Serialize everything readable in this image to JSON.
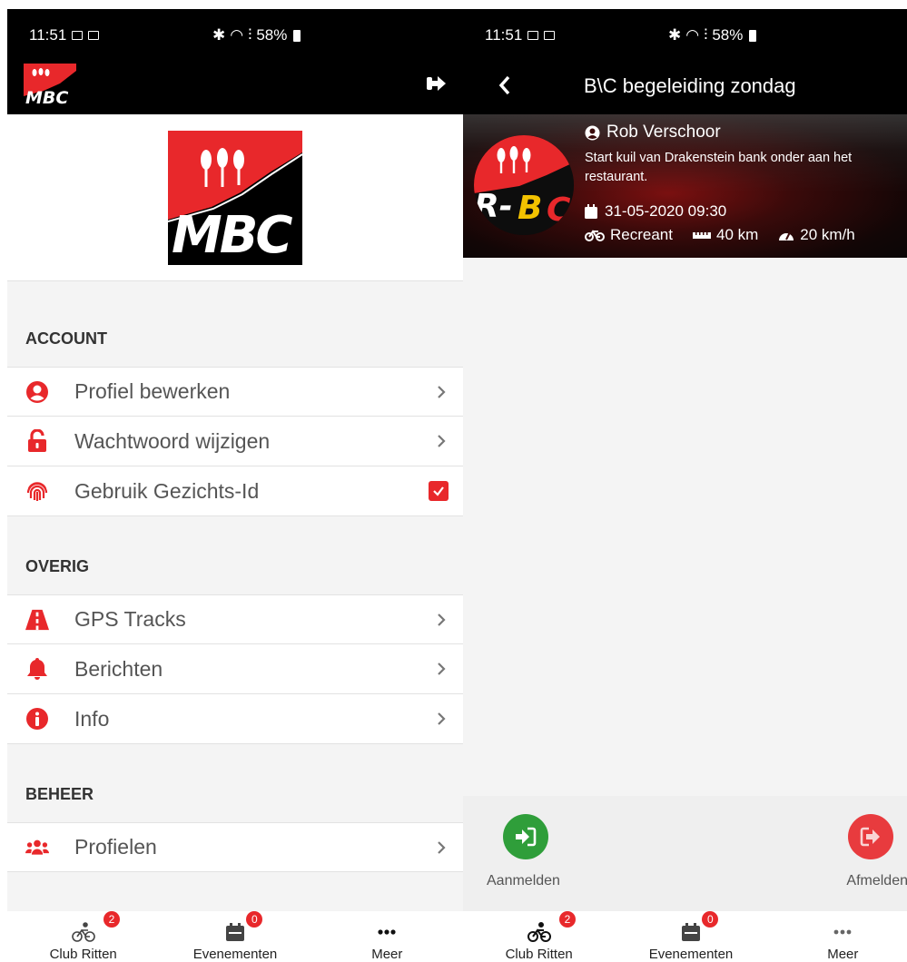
{
  "status_bar": {
    "time": "11:51",
    "battery": "58%"
  },
  "left": {
    "sections": [
      {
        "title": "ACCOUNT",
        "items": [
          {
            "label": "Profiel bewerken",
            "icon": "user-circle-icon",
            "type": "chevron"
          },
          {
            "label": "Wachtwoord wijzigen",
            "icon": "lock-open-icon",
            "type": "chevron"
          },
          {
            "label": "Gebruik Gezichts-Id",
            "icon": "fingerprint-icon",
            "type": "checkbox",
            "checked": true
          }
        ]
      },
      {
        "title": "OVERIG",
        "items": [
          {
            "label": "GPS Tracks",
            "icon": "road-icon",
            "type": "chevron"
          },
          {
            "label": "Berichten",
            "icon": "bell-icon",
            "type": "chevron"
          },
          {
            "label": "Info",
            "icon": "info-circle-icon",
            "type": "chevron"
          }
        ]
      },
      {
        "title": "BEHEER",
        "items": [
          {
            "label": "Profielen",
            "icon": "users-icon",
            "type": "chevron"
          }
        ]
      }
    ]
  },
  "right": {
    "title": "B\\C begeleiding zondag",
    "ride": {
      "owner": "Rob Verschoor",
      "description": "Start kuil van Drakenstein bank onder aan het restaurant.",
      "datetime": "31-05-2020 09:30",
      "level": "Recreant",
      "distance": "40 km",
      "speed": "20 km/h"
    },
    "actions": {
      "join": "Aanmelden",
      "leave": "Afmelden"
    }
  },
  "nav": {
    "items": [
      {
        "label": "Club Ritten",
        "badge": "2"
      },
      {
        "label": "Evenementen",
        "badge": "0"
      },
      {
        "label": "Meer"
      }
    ]
  },
  "colors": {
    "brand_red": "#e8282b",
    "join_green": "#2f9e3a",
    "bar_black": "#000000"
  }
}
